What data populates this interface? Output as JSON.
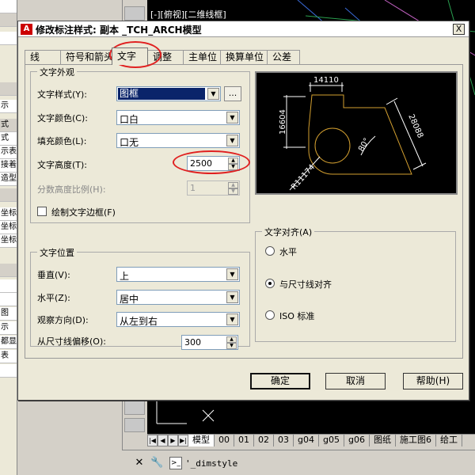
{
  "background": {
    "left_rows": [
      "",
      "",
      "",
      "",
      "示",
      "式",
      "示表",
      "接着到",
      "造型",
      "",
      "坐标",
      "坐标",
      "坐标",
      "",
      "",
      "",
      "图",
      "示",
      "都显",
      "表",
      "",
      ""
    ],
    "cad_title": "[-][俯视][二维线框]",
    "model_tabs": [
      "模型",
      "00",
      "01",
      "02",
      "03",
      "g04",
      "g05",
      "g06",
      "图纸",
      "施工图6",
      "给工"
    ],
    "cmd_prompt_icon": ">_",
    "command_text": "'_dimstyle"
  },
  "dialog": {
    "icon_label": "A",
    "title": "修改标注样式: 副本 _TCH_ARCH模型",
    "close_glyph": "X",
    "tabs": [
      "线",
      "符号和箭头",
      "文字",
      "调整",
      "主单位",
      "换算单位",
      "公差"
    ],
    "text_appearance": {
      "title": "文字外观",
      "text_style_label": "文字样式(Y):",
      "text_style_value": "图框",
      "ellipsis": "...",
      "text_color_label": "文字颜色(C):",
      "text_color_value": "口白",
      "fill_color_label": "填充颜色(L):",
      "fill_color_value": "口无",
      "text_height_label": "文字高度(T):",
      "text_height_value": "2500",
      "fraction_scale_label": "分数高度比例(H):",
      "fraction_scale_value": "1",
      "draw_frame_label": "绘制文字边框(F)"
    },
    "text_placement": {
      "title": "文字位置",
      "vertical_label": "垂直(V):",
      "vertical_value": "上",
      "horizontal_label": "水平(Z):",
      "horizontal_value": "居中",
      "view_direction_label": "观察方向(D):",
      "view_direction_value": "从左到右",
      "offset_label": "从尺寸线偏移(O):",
      "offset_value": "300"
    },
    "text_alignment": {
      "title": "文字对齐(A)",
      "options": [
        "水平",
        "与尺寸线对齐",
        "ISO 标准"
      ],
      "selected_index": 1
    },
    "preview": {
      "dim_top": "14110",
      "dim_left": "16604",
      "dim_right": "28088",
      "dim_angle": "80°",
      "dim_radius": "R11174"
    },
    "buttons": {
      "ok": "确定",
      "cancel": "取消",
      "help": "帮助(H)"
    }
  },
  "colors": {
    "accent_highlight": "#e02020",
    "selection_bg": "#0a246a",
    "preview_geometry": "#d4a030",
    "preview_dims": "#ffffff"
  }
}
